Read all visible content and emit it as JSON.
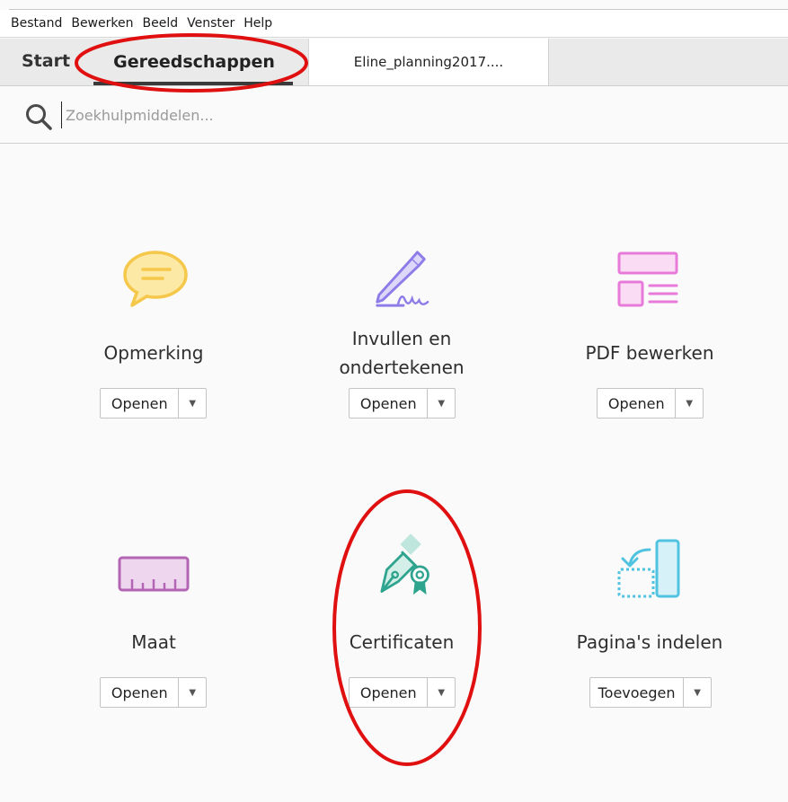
{
  "menubar": {
    "items": [
      "Bestand",
      "Bewerken",
      "Beeld",
      "Venster",
      "Help"
    ]
  },
  "tabs": {
    "start": "Start",
    "tools": "Gereedschappen",
    "document": "Eline_planning2017...."
  },
  "search": {
    "placeholder": "Zoekhulpmiddelen..."
  },
  "tools": [
    {
      "label_lines": [
        "Opmerking"
      ],
      "button": "Openen",
      "icon": "comment-icon",
      "color": "#f5c74a"
    },
    {
      "label_lines": [
        "Invullen en",
        "ondertekenen"
      ],
      "button": "Openen",
      "icon": "fill-sign-icon",
      "color": "#8e7de8"
    },
    {
      "label_lines": [
        "PDF bewerken"
      ],
      "button": "Openen",
      "icon": "edit-pdf-icon",
      "color": "#e87ad9"
    },
    {
      "label_lines": [
        "Maat"
      ],
      "button": "Openen",
      "icon": "measure-ruler-icon",
      "color": "#b364b3"
    },
    {
      "label_lines": [
        "Certificaten"
      ],
      "button": "Openen",
      "icon": "certificate-pen-icon",
      "color": "#2ea38e"
    },
    {
      "label_lines": [
        "Pagina's indelen"
      ],
      "button": "Toevoegen",
      "icon": "organize-pages-icon",
      "color": "#4fc3e0"
    }
  ],
  "colors": {
    "annotation_red": "#e01010"
  }
}
